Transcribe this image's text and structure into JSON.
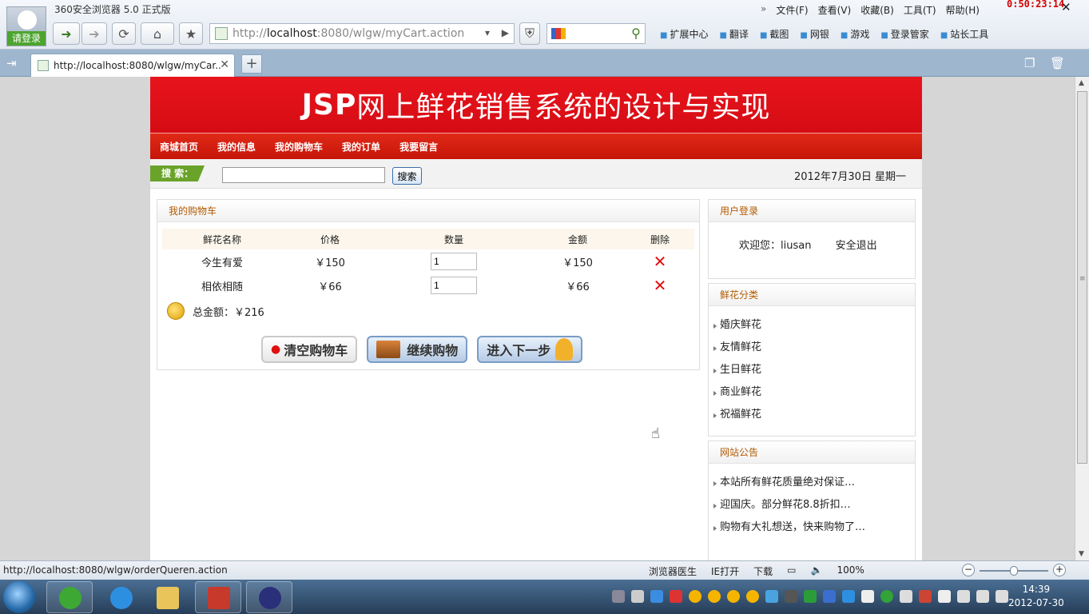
{
  "browser": {
    "title": "360安全浏览器 5.0 正式版",
    "login_label": "请登录",
    "menu": [
      "文件(F)",
      "查看(V)",
      "收藏(B)",
      "工具(T)",
      "帮助(H)"
    ],
    "timer": "0:50:23:14",
    "url_prefix": "http://",
    "url_host": "localhost",
    "url_rest": ":8080/wlgw/myCart.action",
    "tools": [
      "扩展中心",
      "翻译",
      "截图",
      "网银",
      "游戏",
      "登录管家",
      "站长工具"
    ],
    "tab_title": "http://localhost:8080/wlgw/myCar...",
    "status_url": "http://localhost:8080/wlgw/orderQueren.action",
    "status_items": [
      "浏览器医生",
      "IE打开",
      "下载"
    ],
    "zoom": "100%",
    "clock_time": "14:39",
    "clock_date": "2012-07-30"
  },
  "site": {
    "banner_en": "JSP",
    "banner_cn": "网上鲜花销售系统的设计与实现",
    "nav": [
      "商城首页",
      "我的信息",
      "我的购物车",
      "我的订单",
      "我要留言"
    ],
    "search_tag": "搜 索：",
    "search_value": "",
    "search_button": "搜索",
    "date": "2012年7月30日 星期一"
  },
  "cart": {
    "title": "我的购物车",
    "headers": [
      "鲜花名称",
      "价格",
      "数量",
      "金额",
      "删除"
    ],
    "rows": [
      {
        "name": "今生有爱",
        "price": "￥150",
        "qty": "1",
        "amount": "￥150"
      },
      {
        "name": "相依相随",
        "price": "￥66",
        "qty": "1",
        "amount": "￥66"
      }
    ],
    "total_label": "总金额：￥216",
    "buttons": {
      "clear": "清空购物车",
      "continue": "继续购物",
      "next": "进入下一步"
    }
  },
  "sidebar": {
    "login_title": "用户登录",
    "welcome": "欢迎您：liusan",
    "logout": "安全退出",
    "category_title": "鲜花分类",
    "categories": [
      "婚庆鲜花",
      "友情鲜花",
      "生日鲜花",
      "商业鲜花",
      "祝福鲜花"
    ],
    "news_title": "网站公告",
    "news": [
      "本站所有鲜花质量绝对保证…",
      "迎国庆。部分鲜花8.8折扣…",
      "购物有大礼想送，快来购物了…"
    ]
  }
}
